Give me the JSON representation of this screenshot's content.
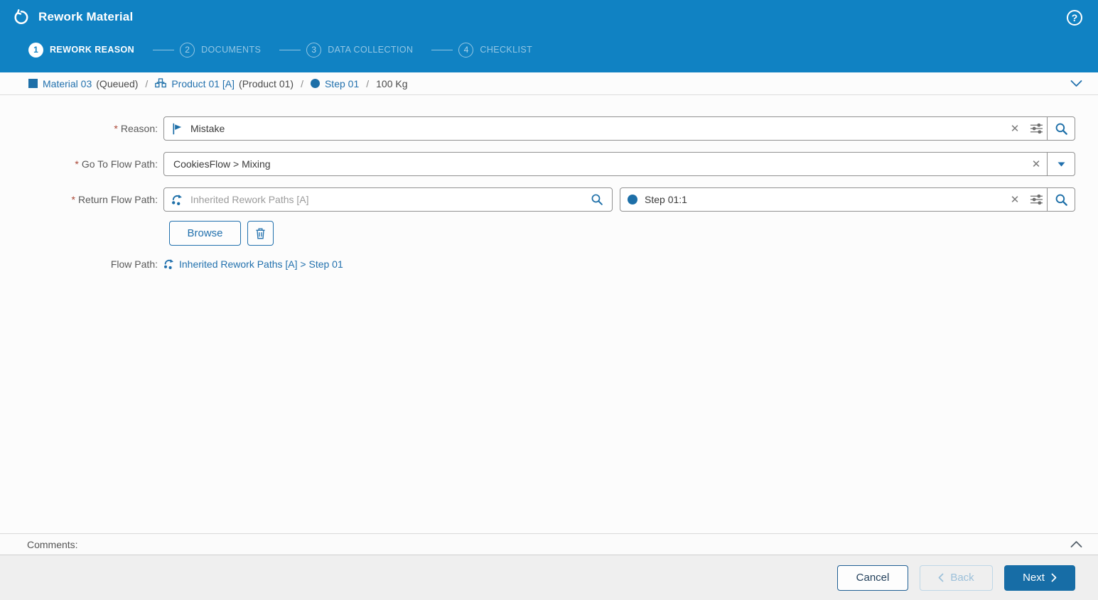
{
  "header": {
    "title": "Rework Material",
    "steps": [
      {
        "number": "1",
        "label": "REWORK REASON",
        "active": true
      },
      {
        "number": "2",
        "label": "DOCUMENTS",
        "active": false
      },
      {
        "number": "3",
        "label": "DATA COLLECTION",
        "active": false
      },
      {
        "number": "4",
        "label": "CHECKLIST",
        "active": false
      }
    ]
  },
  "breadcrumb": {
    "separator": "/",
    "material": {
      "label": "Material 03",
      "status": "(Queued)"
    },
    "product": {
      "label": "Product 01 [A]",
      "status": "(Product 01)"
    },
    "step": {
      "label": "Step 01"
    },
    "quantity": "100 Kg"
  },
  "form": {
    "required_mark": "*",
    "reason": {
      "label": "Reason:",
      "value": "Mistake"
    },
    "goto_flow_path": {
      "label": "Go To Flow Path:",
      "value": "CookiesFlow > Mixing"
    },
    "return_flow_path": {
      "label": "Return Flow Path:",
      "flow_value": "Inherited Rework Paths [A]",
      "step_value": "Step 01:1"
    },
    "browse_label": "Browse",
    "flow_path_summary": {
      "label": "Flow Path:",
      "value": "Inherited Rework Paths [A] > Step 01"
    },
    "clear_glyph": "✕"
  },
  "comments": {
    "label": "Comments:"
  },
  "footer": {
    "cancel_label": "Cancel",
    "back_label": "Back",
    "next_label": "Next"
  },
  "icons": {
    "header_back": "undo-arrow",
    "help": "question-circle",
    "material": "blue-square",
    "product": "sitemap",
    "step": "blue-dot",
    "reason": "flag",
    "flow_path": "curved-arrow-dots",
    "clear": "x-cross",
    "advanced_filter": "sliders",
    "search": "magnifier",
    "dropdown": "caret-down",
    "delete": "trash",
    "collapse": "chevron-up",
    "expand": "chevron-down"
  },
  "colors": {
    "header_blue": "#1082c3",
    "accent_blue": "#2170ad",
    "icon_blue": "#1d6fa8",
    "primary_button_blue": "#176da6",
    "required_red": "#a94433",
    "footer_gray": "#efefef"
  }
}
